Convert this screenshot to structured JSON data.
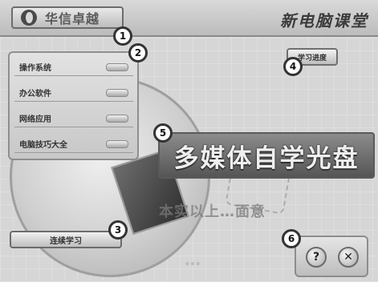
{
  "header": {
    "brand": "华信卓越",
    "title": "新电脑课堂"
  },
  "menu": {
    "items": [
      {
        "label": "操作系统"
      },
      {
        "label": "办公软件"
      },
      {
        "label": "网络应用"
      },
      {
        "label": "电脑技巧大全"
      }
    ]
  },
  "buttons": {
    "progress_label": "学习进度",
    "study_label": "连续学习",
    "help_symbol": "?",
    "close_symbol": "✕"
  },
  "banner": {
    "text": "多媒体自学光盘"
  },
  "watermark": {
    "line1": "本实以上…面意",
    "line2": "…"
  },
  "callouts": [
    "1",
    "2",
    "3",
    "4",
    "5",
    "6"
  ]
}
